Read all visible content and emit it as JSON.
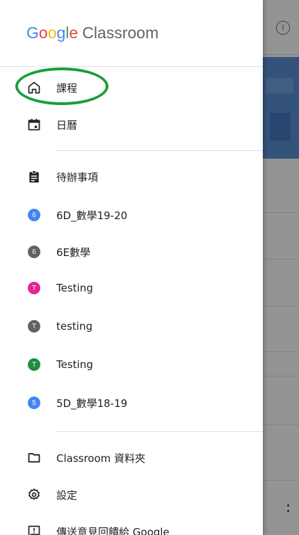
{
  "app": {
    "logo_google": "Google",
    "logo_product": "Classroom"
  },
  "drawer": {
    "top_items": [
      {
        "label": "課程",
        "icon": "home-icon"
      },
      {
        "label": "日曆",
        "icon": "calendar-icon"
      }
    ],
    "todo": {
      "label": "待辦事項",
      "icon": "assignment-icon"
    },
    "classes": [
      {
        "label": "6D_數學19-20",
        "initial": "6",
        "color": "#4285F4"
      },
      {
        "label": "6E數學",
        "initial": "6",
        "color": "#5f6368"
      },
      {
        "label": "Testing",
        "initial": "T",
        "color": "#E52592"
      },
      {
        "label": "testing",
        "initial": "T",
        "color": "#5f6368"
      },
      {
        "label": "Testing",
        "initial": "T",
        "color": "#1E8E3E"
      },
      {
        "label": "5D_數學18-19",
        "initial": "5",
        "color": "#4285F4"
      }
    ],
    "bottom_items": [
      {
        "label": "Classroom 資料夾",
        "icon": "folder-icon"
      },
      {
        "label": "設定",
        "icon": "settings-icon"
      },
      {
        "label": "傳送意見回饋給 Google",
        "icon": "feedback-icon"
      }
    ]
  },
  "annotation_color": "#1a9e3a"
}
